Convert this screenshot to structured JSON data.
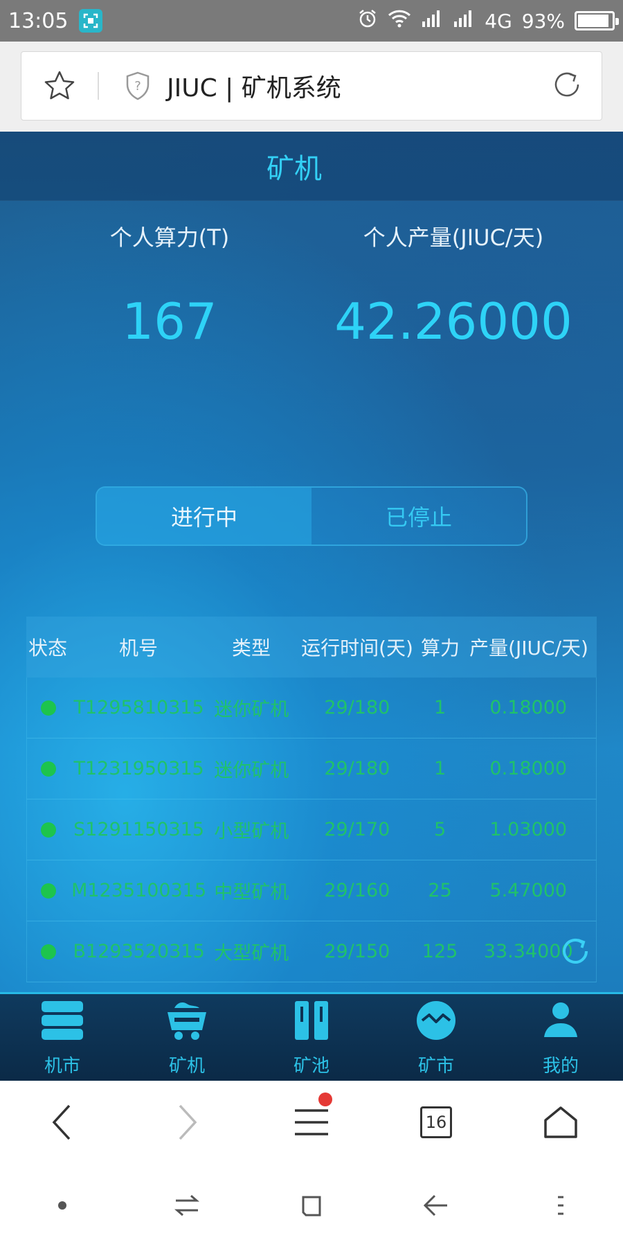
{
  "statusbar": {
    "time": "13:05",
    "network": "4G",
    "battery": "93%",
    "battery_level": 0.93
  },
  "browser": {
    "url_title": "JIUC | 矿机系统",
    "tab_count": "16"
  },
  "app": {
    "title": "矿机",
    "stats": {
      "hashrate_label": "个人算力(T)",
      "hashrate_value": "167",
      "output_label": "个人产量(JIUC/天)",
      "output_value": "42.26000"
    },
    "toggle": {
      "running": "进行中",
      "stopped": "已停止"
    },
    "table": {
      "headers": [
        "状态",
        "机号",
        "类型",
        "运行时间(天)",
        "算力",
        "产量(JIUC/天)"
      ],
      "rows": [
        {
          "id": "T1295810315",
          "type": "迷你矿机",
          "runtime": "29/180",
          "power": "1",
          "output": "0.18000"
        },
        {
          "id": "T1231950315",
          "type": "迷你矿机",
          "runtime": "29/180",
          "power": "1",
          "output": "0.18000"
        },
        {
          "id": "S1291150315",
          "type": "小型矿机",
          "runtime": "29/170",
          "power": "5",
          "output": "1.03000"
        },
        {
          "id": "M1235100315",
          "type": "中型矿机",
          "runtime": "29/160",
          "power": "25",
          "output": "5.47000"
        },
        {
          "id": "B1293520315",
          "type": "大型矿机",
          "runtime": "29/150",
          "power": "125",
          "output": "33.34000"
        }
      ]
    },
    "nav": [
      {
        "label": "机市",
        "icon": "list-icon"
      },
      {
        "label": "矿机",
        "icon": "mine-cart-icon"
      },
      {
        "label": "矿池",
        "icon": "pool-icon"
      },
      {
        "label": "矿市",
        "icon": "market-icon"
      },
      {
        "label": "我的",
        "icon": "user-icon"
      }
    ]
  },
  "colors": {
    "accent": "#2ed3f7",
    "status_green": "#1dc44d",
    "row_text": "#20c26a"
  }
}
